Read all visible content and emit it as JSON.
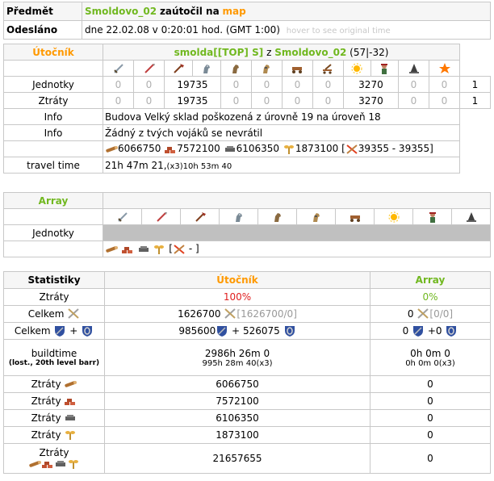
{
  "header": {
    "subject_label": "Předmět",
    "subject_player": "Smoldovo_02",
    "subject_action": "zaútočil na",
    "subject_target": "map",
    "sent_label": "Odesláno",
    "sent_value": "dne 22.02.08 v 0:20:01 hod. (GMT 1:00)",
    "sent_hint": "hover to see original time"
  },
  "attacker": {
    "title": "Útočník",
    "player": "smolda",
    "alliance": "[[TOP] S]",
    "from_word": "z",
    "village": "Smoldovo_02",
    "coords": "(57|-32)",
    "unit_icons": [
      "sword-icon",
      "spear-icon",
      "axe-icon",
      "scout-horse-icon",
      "light-cavalry-icon",
      "heavy-cavalry-icon",
      "ram-icon",
      "catapult-icon",
      "sun-icon",
      "chief-icon",
      "settler-icon",
      "hero-star-icon"
    ],
    "rows": [
      {
        "label": "Jednotky",
        "values": [
          "0",
          "0",
          "19735",
          "0",
          "0",
          "0",
          "0",
          "3270",
          "0",
          "0",
          "1"
        ]
      },
      {
        "label": "Ztráty",
        "values": [
          "0",
          "0",
          "19735",
          "0",
          "0",
          "0",
          "0",
          "3270",
          "0",
          "0",
          "1"
        ]
      }
    ],
    "info1_label": "Info",
    "info1_text": "Budova Velký sklad poškozená z úrovně 19 na úroveň 18",
    "info2_label": "Info",
    "info2_text": "Žádný z tvých vojáků se nevrátil",
    "res": {
      "wood": "6066750",
      "clay": "7572100",
      "iron": "6106350",
      "crop": "1873100",
      "bounty": "39355 - 39355"
    },
    "travel_label": "travel time",
    "travel_value": "21h 47m 21,",
    "travel_small": "(x3)10h 53m 40"
  },
  "defender": {
    "title": "Array",
    "unit_icons": [
      "sword-icon",
      "spear-icon",
      "axe-icon",
      "scout-horse-icon",
      "light-cavalry-icon",
      "heavy-cavalry-icon",
      "ram-icon",
      "sun-icon",
      "chief-icon",
      "settler-icon"
    ],
    "units_label": "Jednotky",
    "bounty_value": "-"
  },
  "stats": {
    "title": "Statistiky",
    "col_attacker": "Útočník",
    "col_defender": "Array",
    "losses_label": "Ztráty",
    "losses_att": "100%",
    "losses_def": "0%",
    "total_label": "Celkem",
    "total_att": "1626700",
    "total_att_paren": "[1626700/0]",
    "total_def": "0",
    "total_def_paren": "[0/0]",
    "def_label": "Celkem",
    "plus": "+",
    "def_att_a": "985600",
    "def_att_b": "526075",
    "def_def_a": "0",
    "def_def_b": "+0",
    "build_label": "buildtime",
    "build_sub": "(lost., 20th level barr)",
    "build_att": "2986h 26m 0",
    "build_att_small": "995h 28m 40(x3)",
    "build_def": "0h 0m 0",
    "build_def_small": "0h 0m 0(x3)",
    "loss_rows": [
      {
        "label": "Ztráty",
        "icon": "wood-icon",
        "att": "6066750",
        "def": "0"
      },
      {
        "label": "Ztráty",
        "icon": "clay-icon",
        "att": "7572100",
        "def": "0"
      },
      {
        "label": "Ztráty",
        "icon": "iron-icon",
        "att": "6106350",
        "def": "0"
      },
      {
        "label": "Ztráty",
        "icon": "crop-icon",
        "att": "1873100",
        "def": "0"
      }
    ],
    "loss_total_label": "Ztráty",
    "loss_total_att": "21657655",
    "loss_total_def": "0"
  },
  "colors": {
    "green": "#71b820",
    "orange": "#ff9900",
    "red": "#e02020"
  }
}
